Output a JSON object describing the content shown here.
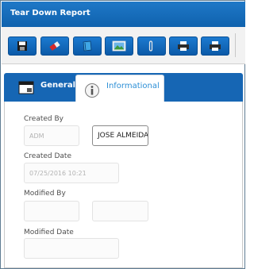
{
  "window": {
    "title": "Tear Down Report"
  },
  "toolbar": {
    "buttons": [
      {
        "name": "save",
        "icon": "floppy-disk-icon"
      },
      {
        "name": "eraser",
        "icon": "eraser-icon"
      },
      {
        "name": "notebook",
        "icon": "notebook-icon"
      },
      {
        "name": "image",
        "icon": "image-icon"
      },
      {
        "name": "attach",
        "icon": "paperclip-icon"
      },
      {
        "name": "print",
        "icon": "printer-icon"
      },
      {
        "name": "print-preview",
        "icon": "printer-icon"
      }
    ]
  },
  "tabs": {
    "general": {
      "label": "General",
      "icon": "window-icon"
    },
    "informational": {
      "label": "Informational",
      "icon": "info-icon",
      "active": true
    }
  },
  "form": {
    "created_by": {
      "label": "Created By",
      "value": "ADM",
      "name_value": "JOSE ALMEIDA"
    },
    "created_date": {
      "label": "Created Date",
      "value": "07/25/2016 10:21"
    },
    "modified_by": {
      "label": "Modified By",
      "value": "",
      "name_value": ""
    },
    "modified_date": {
      "label": "Modified Date",
      "value": ""
    }
  },
  "colors": {
    "accent": "#1666b4",
    "title_bar": "#1470c2",
    "active_tab_text": "#2c8fd6"
  }
}
